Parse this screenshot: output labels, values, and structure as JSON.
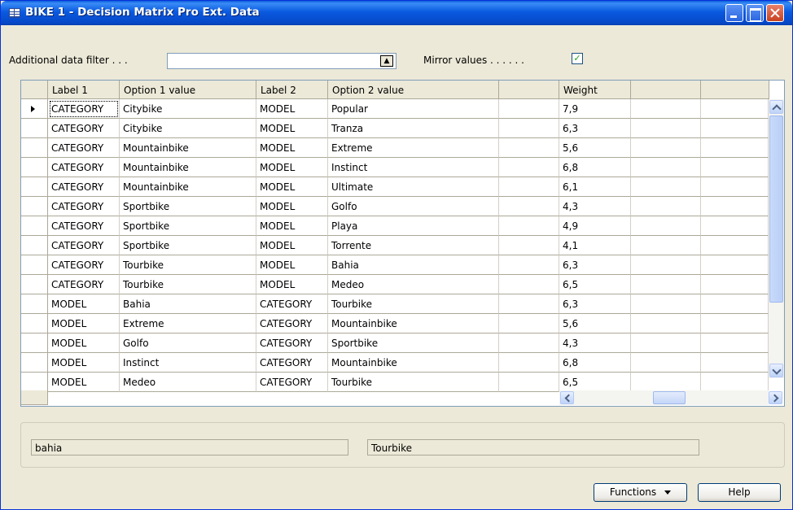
{
  "window": {
    "title": "BIKE 1 - Decision Matrix Pro Ext. Data"
  },
  "filter": {
    "label": "Additional data filter . . .",
    "value": "",
    "lookup_icon": "arrow-up-icon"
  },
  "mirror": {
    "label": "Mirror values . . . . . .",
    "checked": true,
    "mark": "✓"
  },
  "grid": {
    "columns": [
      "Label 1",
      "Option 1 value",
      "Label 2",
      "Option 2 value",
      "",
      "Weight",
      "",
      ""
    ],
    "rows": [
      {
        "label1": "CATEGORY",
        "option1": "Citybike",
        "label2": "MODEL",
        "option2": "Popular",
        "weight": "7,9"
      },
      {
        "label1": "CATEGORY",
        "option1": "Citybike",
        "label2": "MODEL",
        "option2": "Tranza",
        "weight": "6,3"
      },
      {
        "label1": "CATEGORY",
        "option1": "Mountainbike",
        "label2": "MODEL",
        "option2": "Extreme",
        "weight": "5,6"
      },
      {
        "label1": "CATEGORY",
        "option1": "Mountainbike",
        "label2": "MODEL",
        "option2": "Instinct",
        "weight": "6,8"
      },
      {
        "label1": "CATEGORY",
        "option1": "Mountainbike",
        "label2": "MODEL",
        "option2": "Ultimate",
        "weight": "6,1"
      },
      {
        "label1": "CATEGORY",
        "option1": "Sportbike",
        "label2": "MODEL",
        "option2": "Golfo",
        "weight": "4,3"
      },
      {
        "label1": "CATEGORY",
        "option1": "Sportbike",
        "label2": "MODEL",
        "option2": "Playa",
        "weight": "4,9"
      },
      {
        "label1": "CATEGORY",
        "option1": "Sportbike",
        "label2": "MODEL",
        "option2": "Torrente",
        "weight": "4,1"
      },
      {
        "label1": "CATEGORY",
        "option1": "Tourbike",
        "label2": "MODEL",
        "option2": "Bahia",
        "weight": "6,3"
      },
      {
        "label1": "CATEGORY",
        "option1": "Tourbike",
        "label2": "MODEL",
        "option2": "Medeo",
        "weight": "6,5"
      },
      {
        "label1": "MODEL",
        "option1": "Bahia",
        "label2": "CATEGORY",
        "option2": "Tourbike",
        "weight": "6,3"
      },
      {
        "label1": "MODEL",
        "option1": "Extreme",
        "label2": "CATEGORY",
        "option2": "Mountainbike",
        "weight": "5,6"
      },
      {
        "label1": "MODEL",
        "option1": "Golfo",
        "label2": "CATEGORY",
        "option2": "Sportbike",
        "weight": "4,3"
      },
      {
        "label1": "MODEL",
        "option1": "Instinct",
        "label2": "CATEGORY",
        "option2": "Mountainbike",
        "weight": "6,8"
      },
      {
        "label1": "MODEL",
        "option1": "Medeo",
        "label2": "CATEGORY",
        "option2": "Tourbike",
        "weight": "6,5"
      }
    ]
  },
  "info": {
    "left": "bahia",
    "right": "Tourbike"
  },
  "buttons": {
    "functions": "Functions",
    "help": "Help"
  }
}
